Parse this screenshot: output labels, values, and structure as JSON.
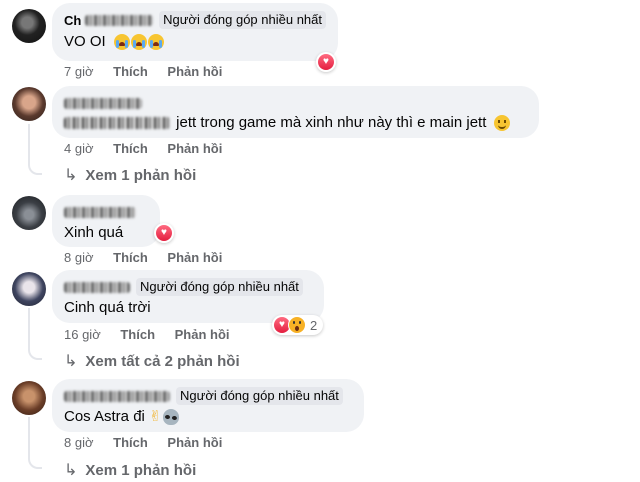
{
  "comments": [
    {
      "name_visible": "Ch",
      "badge": "Người đóng góp nhiều nhất",
      "text": "VO OI",
      "emoji": [
        "crying-face",
        "crying-face",
        "crying-face"
      ],
      "time": "7 giờ",
      "like": "Thích",
      "reply": "Phản hồi",
      "reactions": [
        "love"
      ],
      "reaction_count": ""
    },
    {
      "name_visible": "",
      "badge": "",
      "text": "jett trong game mà xinh như này thì e main jett",
      "emoji": [
        "smiling-face"
      ],
      "time": "4 giờ",
      "like": "Thích",
      "reply": "Phản hồi",
      "view_replies": "Xem 1 phản hồi"
    },
    {
      "name_visible": "",
      "badge": "",
      "text": "Xinh quá",
      "time": "8 giờ",
      "like": "Thích",
      "reply": "Phản hồi",
      "reactions": [
        "love"
      ]
    },
    {
      "name_visible": "",
      "badge": "Người đóng góp nhiều nhất",
      "text": "Cinh quá trời",
      "time": "16 giờ",
      "like": "Thích",
      "reply": "Phản hồi",
      "reactions": [
        "love",
        "wow"
      ],
      "reaction_count": "2",
      "view_replies": "Xem tất cả 2 phản hồi"
    },
    {
      "name_visible": "",
      "badge": "Người đóng góp nhiều nhất",
      "text": "Cos Astra đi",
      "emoji": [
        "victory-hand",
        "alien"
      ],
      "time": "8 giờ",
      "like": "Thích",
      "reply": "Phản hồi",
      "view_replies": "Xem 1 phản hồi"
    }
  ],
  "colors": {
    "bubble": "#f0f2f5",
    "meta_text": "#65676b",
    "love": "#e41e3f",
    "badge_bg": "#e4e6eb"
  }
}
